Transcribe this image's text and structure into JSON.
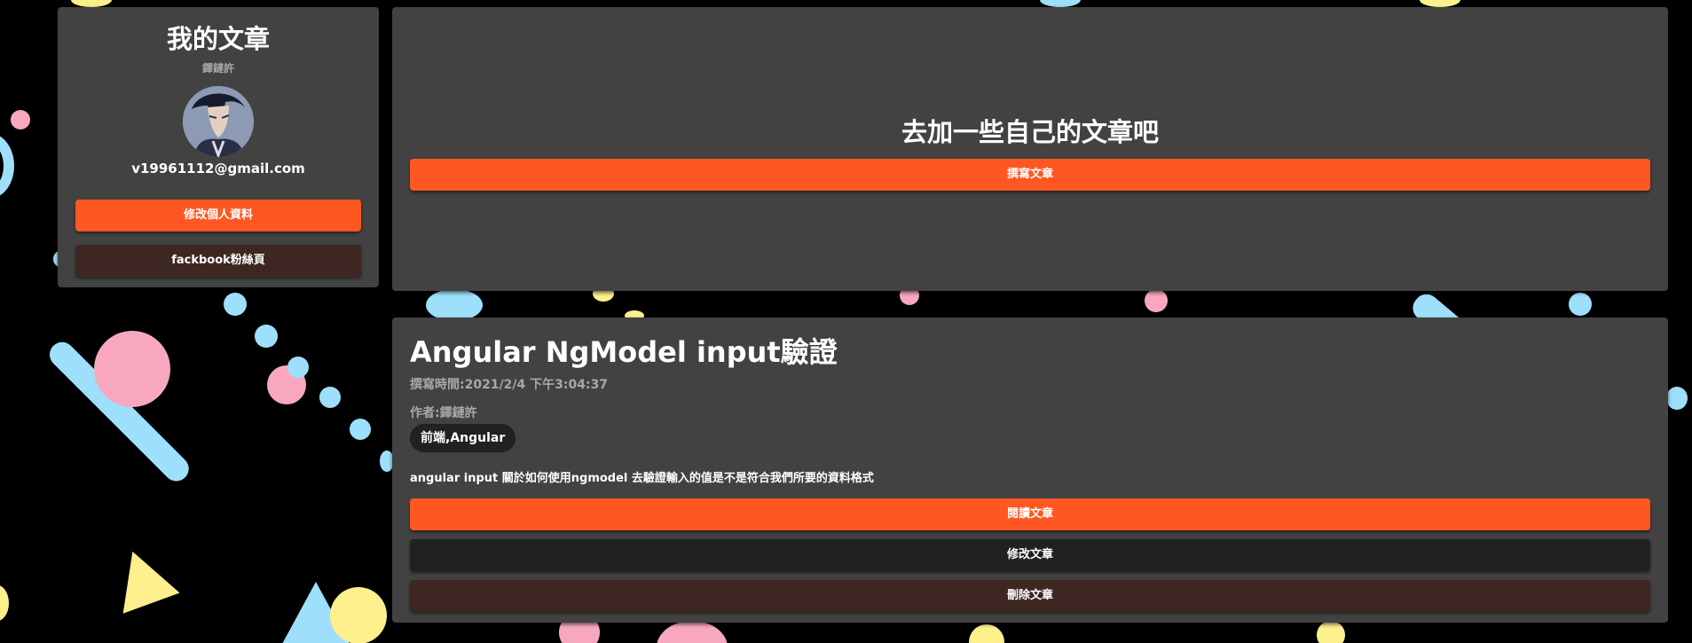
{
  "profile": {
    "title": "我的文章",
    "subtitle": "鐸鏈許",
    "email": "v19961112@gmail.com",
    "edit_profile_label": "修改個人資料",
    "facebook_label": "fackbook粉絲頁"
  },
  "cta": {
    "heading": "去加一些自己的文章吧",
    "write_label": "撰寫文章"
  },
  "article": {
    "title": "Angular NgModel input驗證",
    "time": "撰寫時間:2021/2/4 下午3:04:37",
    "author": "作者:鐸鏈許",
    "tags": "前端,Angular",
    "description": "angular input 關於如何使用ngmodel 去驗證輸入的值是不是符合我們所要的資料格式",
    "read_label": "閱讀文章",
    "edit_label": "修改文章",
    "delete_label": "刪除文章"
  },
  "icons": {
    "avatar": "anime-character-avatar"
  },
  "colors": {
    "background": "#000000",
    "card": "#424242",
    "primary_button": "#ff5722",
    "dark_button": "#212121",
    "danger_button": "#3e2723",
    "deco_blue": "#9ee0fb",
    "deco_pink": "#f7a8bf",
    "deco_yellow": "#fdef8c"
  }
}
